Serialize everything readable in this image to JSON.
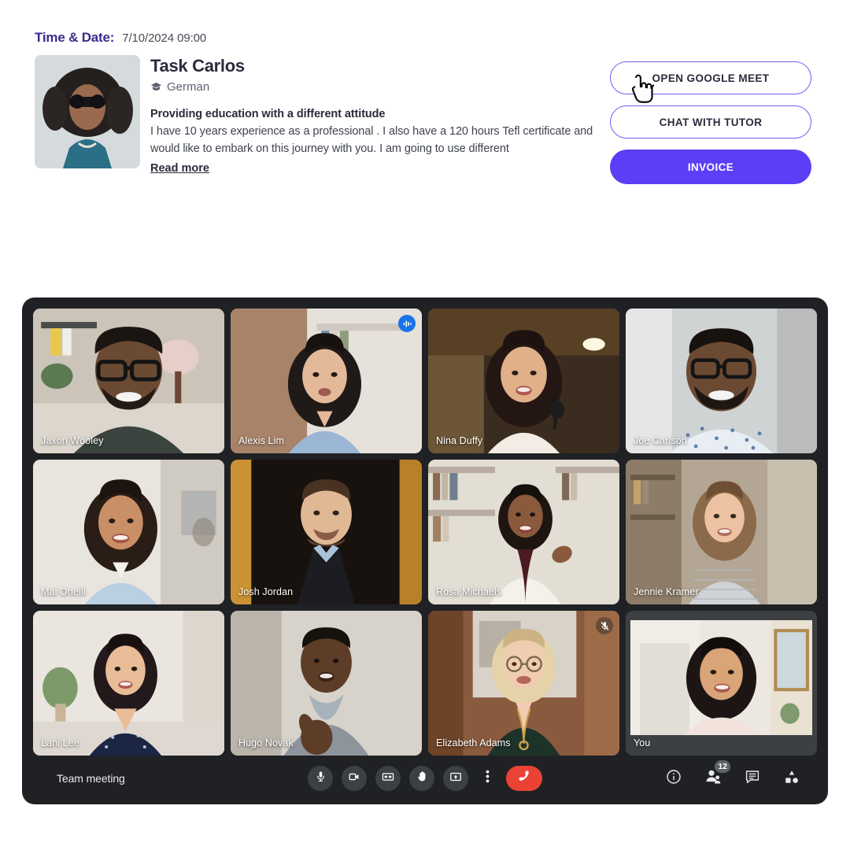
{
  "booking": {
    "time_label": "Time & Date:",
    "time_value": "7/10/2024 09:00",
    "tutor_name": "Task Carlos",
    "tutor_language": "German",
    "language_icon": "graduation-cap-icon",
    "headline": "Providing education with a different attitude",
    "description": "I have 10 years experience as a professional . I also have a 120 hours Tefl certificate and would like to embark on this journey with you. I am going to use different",
    "read_more": "Read more",
    "buttons": {
      "open_meet": "OPEN GOOGLE MEET",
      "chat_tutor": "CHAT WITH TUTOR",
      "invoice": "INVOICE"
    },
    "cursor": "pointing-hand-cursor",
    "colors": {
      "accent_purple": "#5b3ef5",
      "outline_purple": "#7b5cf0",
      "heading_navy": "#3b2a8c"
    }
  },
  "meeting": {
    "title": "Team meeting",
    "participants": [
      {
        "name": "Jaxon Wooley",
        "status": "none"
      },
      {
        "name": "Alexis Lim",
        "status": "speaking"
      },
      {
        "name": "Nina Duffy",
        "status": "none"
      },
      {
        "name": "Joe Carlson",
        "status": "none"
      },
      {
        "name": "Mai Oneill",
        "status": "none"
      },
      {
        "name": "Josh Jordan",
        "status": "none"
      },
      {
        "name": "Rosa Michaels",
        "status": "none"
      },
      {
        "name": "Jennie Kramer",
        "status": "none"
      },
      {
        "name": "Lani Lee",
        "status": "none"
      },
      {
        "name": "Hugo Novak",
        "status": "none"
      },
      {
        "name": "Elizabeth Adams",
        "status": "muted"
      },
      {
        "name": "You",
        "status": "self"
      }
    ],
    "controls": [
      {
        "icon": "microphone-icon",
        "label": "Microphone"
      },
      {
        "icon": "camera-icon",
        "label": "Camera"
      },
      {
        "icon": "closed-captions-icon",
        "label": "Closed captions"
      },
      {
        "icon": "raise-hand-icon",
        "label": "Raise hand"
      },
      {
        "icon": "present-screen-icon",
        "label": "Present screen"
      },
      {
        "icon": "more-options-icon",
        "label": "More options"
      },
      {
        "icon": "end-call-icon",
        "label": "Leave call"
      }
    ],
    "right_icons": [
      {
        "icon": "info-icon",
        "label": "Meeting details",
        "badge": ""
      },
      {
        "icon": "people-icon",
        "label": "People",
        "badge": "12"
      },
      {
        "icon": "chat-icon",
        "label": "Chat",
        "badge": ""
      },
      {
        "icon": "activities-icon",
        "label": "Activities",
        "badge": ""
      }
    ],
    "colors": {
      "window_bg": "#202124",
      "control_bg": "#3c4043",
      "hangup_red": "#ea4335",
      "speaking_blue": "#1a73e8"
    }
  }
}
